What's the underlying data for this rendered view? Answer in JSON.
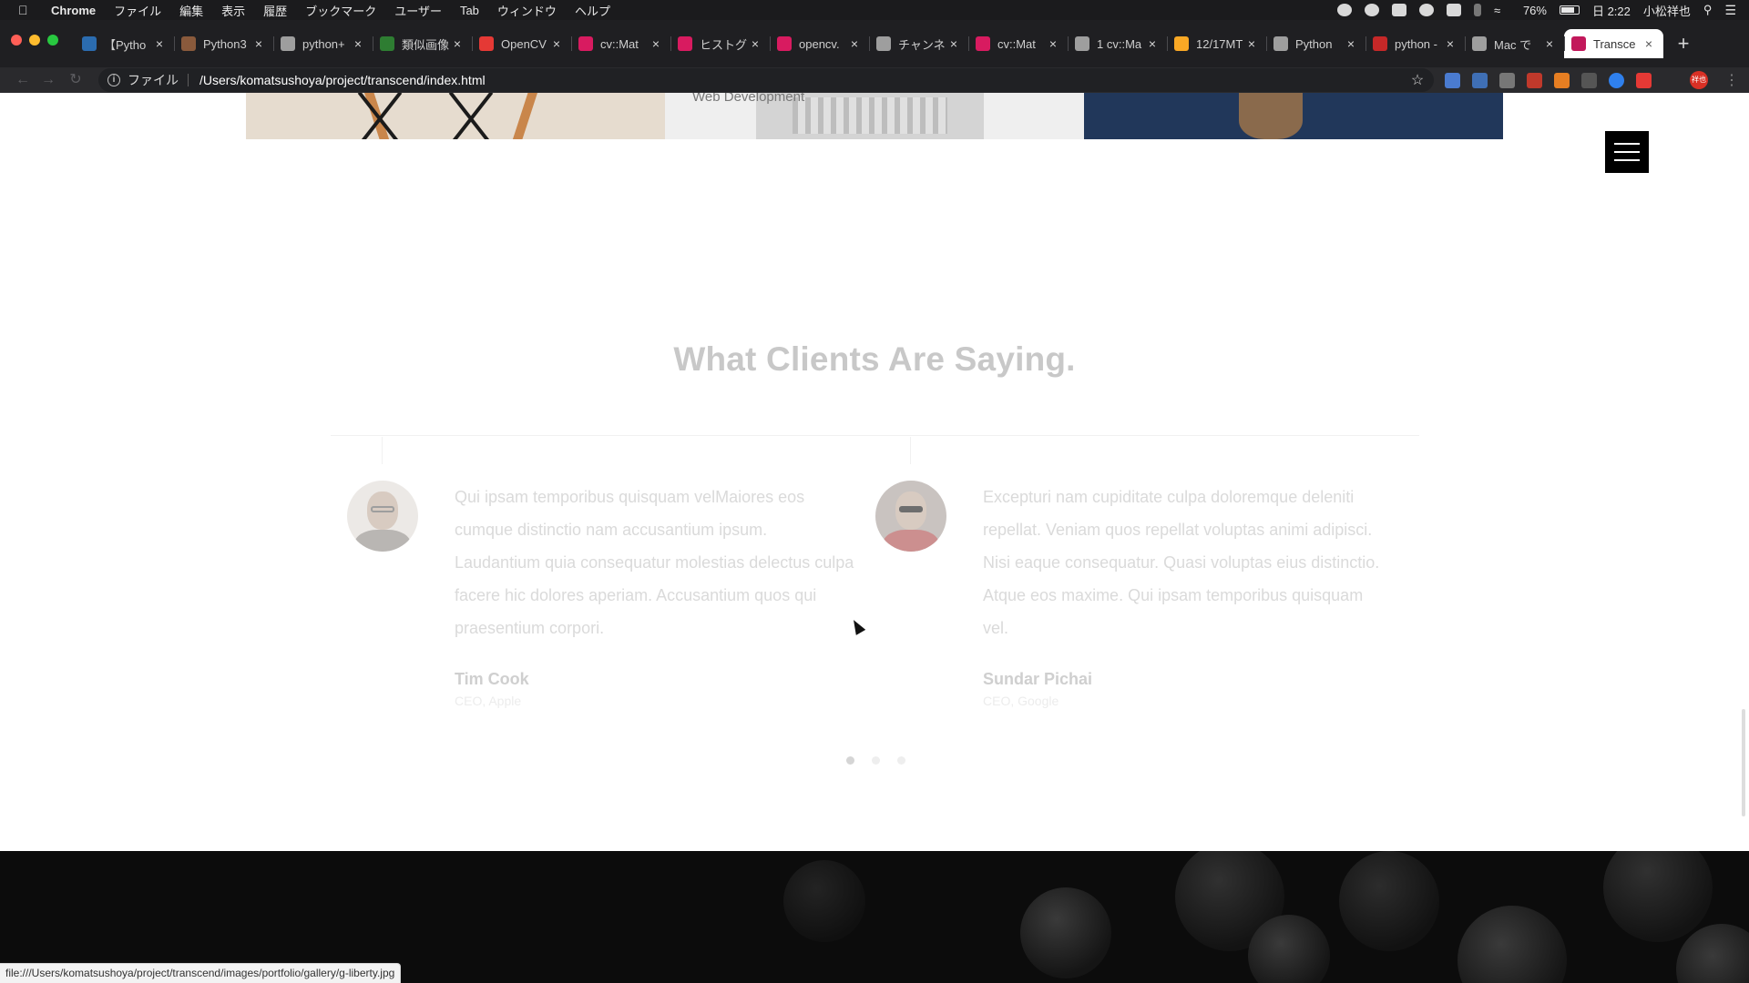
{
  "menubar": {
    "items": [
      "Chrome",
      "ファイル",
      "編集",
      "表示",
      "履歴",
      "ブックマーク",
      "ユーザー",
      "Tab",
      "ウィンドウ",
      "ヘルプ"
    ],
    "battery": "76%",
    "clock": "日 2:22",
    "user": "小松祥也"
  },
  "tabs": [
    {
      "title": "【Pytho",
      "favicon_color": "#2b6cb0"
    },
    {
      "title": "Python3",
      "favicon_color": "#8a5a3c"
    },
    {
      "title": "python+",
      "favicon_color": "#9e9e9e"
    },
    {
      "title": "類似画像",
      "favicon_color": "#2e7d32"
    },
    {
      "title": "OpenCV",
      "favicon_color": "#e53935"
    },
    {
      "title": "cv::Mat",
      "favicon_color": "#d81b60"
    },
    {
      "title": "ヒストグ",
      "favicon_color": "#d81b60"
    },
    {
      "title": "opencv.",
      "favicon_color": "#d81b60"
    },
    {
      "title": "チャンネ",
      "favicon_color": "#9e9e9e"
    },
    {
      "title": "cv::Mat",
      "favicon_color": "#d81b60"
    },
    {
      "title": "1 cv::Ma",
      "favicon_color": "#9e9e9e"
    },
    {
      "title": "12/17MT",
      "favicon_color": "#f9a825"
    },
    {
      "title": "Python",
      "favicon_color": "#9e9e9e"
    },
    {
      "title": "python -",
      "favicon_color": "#c62828"
    },
    {
      "title": "Mac で",
      "favicon_color": "#9e9e9e"
    },
    {
      "title": "Transce",
      "favicon_color": "#c2185b",
      "active": true
    }
  ],
  "address": {
    "scheme_label": "ファイル",
    "url": "/Users/komatsushoya/project/transcend/index.html"
  },
  "page": {
    "gallery_caption": "Web Development",
    "section_title": "What Clients Are Saying.",
    "testimonials": [
      {
        "quote": "Qui ipsam temporibus quisquam velMaiores eos cumque distinctio nam accusantium ipsum. Laudantium quia consequatur molestias delectus culpa facere hic dolores aperiam. Accusantium quos qui praesentium corpori.",
        "name": "Tim Cook",
        "role": "CEO, Apple"
      },
      {
        "quote": "Excepturi nam cupiditate culpa doloremque deleniti repellat. Veniam quos repellat voluptas animi adipisci. Nisi eaque consequatur. Quasi voluptas eius distinctio. Atque eos maxime. Qui ipsam temporibus quisquam vel.",
        "name": "Sundar Pichai",
        "role": "CEO, Google"
      }
    ],
    "pagination": {
      "count": 3,
      "active_index": 0
    }
  },
  "status_url": "file:///Users/komatsushoya/project/transcend/images/portfolio/gallery/g-liberty.jpg",
  "colors": {
    "title_gray": "#c8c8c8",
    "quote_gray": "#dadada",
    "dark_section": "#0c0c0c"
  }
}
